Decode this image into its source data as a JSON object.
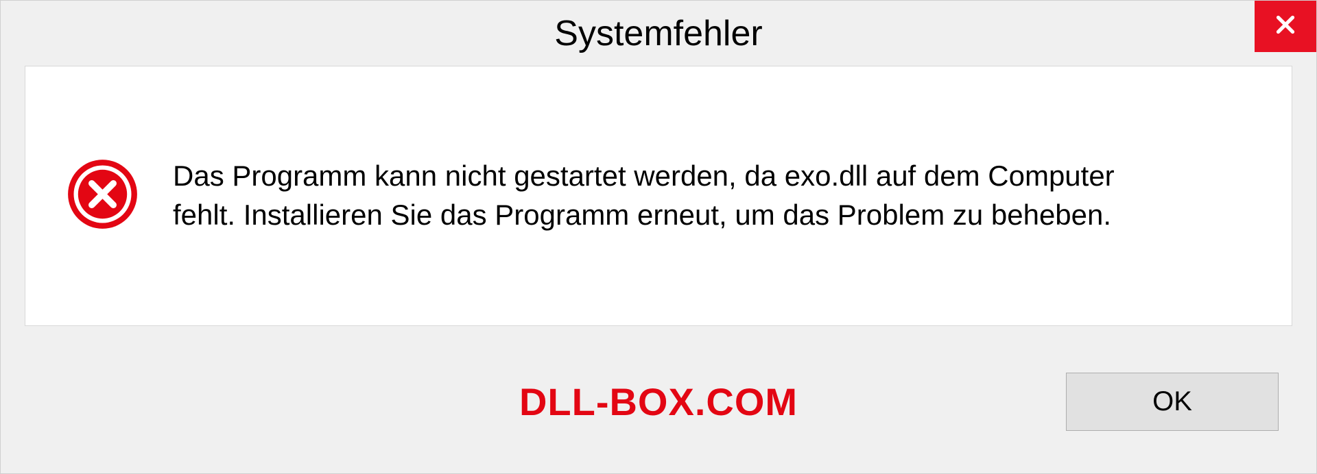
{
  "dialog": {
    "title": "Systemfehler",
    "message": "Das Programm kann nicht gestartet werden, da exo.dll auf dem Computer fehlt. Installieren Sie das Programm erneut, um das Problem zu beheben.",
    "ok_label": "OK"
  },
  "watermark": "DLL-BOX.COM"
}
